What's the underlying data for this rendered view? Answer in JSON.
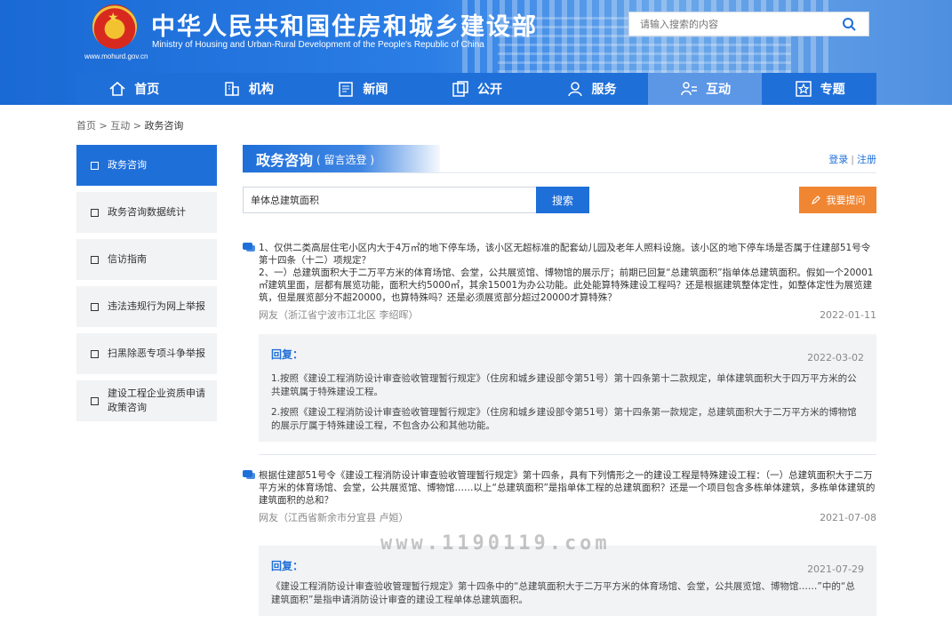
{
  "header": {
    "title": "中华人民共和国住房和城乡建设部",
    "subtitle": "Ministry of Housing and Urban-Rural Development of the People's Republic of China",
    "url": "www.mohurd.gov.cn",
    "search_placeholder": "请输入搜索的内容"
  },
  "nav": [
    {
      "label": "首页",
      "icon": "home-icon"
    },
    {
      "label": "机构",
      "icon": "building-icon"
    },
    {
      "label": "新闻",
      "icon": "news-icon"
    },
    {
      "label": "公开",
      "icon": "folder-icon"
    },
    {
      "label": "服务",
      "icon": "service-icon"
    },
    {
      "label": "互动",
      "icon": "interact-icon"
    },
    {
      "label": "专题",
      "icon": "star-icon"
    }
  ],
  "breadcrumb": {
    "home": "首页",
    "sep": ">",
    "section": "互动",
    "current": "政务咨询"
  },
  "sidebar": [
    {
      "label": "政务咨询"
    },
    {
      "label": "政务咨询数据统计"
    },
    {
      "label": "信访指南"
    },
    {
      "label": "违法违规行为网上举报"
    },
    {
      "label": "扫黑除恶专项斗争举报"
    },
    {
      "label": "建设工程企业资质申请政策咨询"
    }
  ],
  "main": {
    "title": "政务咨询",
    "title_note": "( 留言选登 )",
    "login": "登录",
    "register": "注册",
    "search_value": "单体总建筑面积",
    "search_button": "搜索",
    "ask_button": "我要提问"
  },
  "questions": [
    {
      "lines": [
        "1、仅供二类高层住宅小区内大于4万㎡的地下停车场，该小区无超标准的配套幼儿园及老年人照料设施。该小区的地下停车场是否属于住建部51号令第十四条（十二）项规定？",
        "2、一）总建筑面积大于二万平方米的体育场馆、会堂，公共展览馆、博物馆的展示厅；前期已回复“总建筑面积”指单体总建筑面积。假如一个20001㎡建筑里面，层都有展览功能，面积大约5000㎡，其余15001为办公功能。此处能算特殊建设工程吗？还是根据建筑整体定性，如整体定性为展览建筑，但是展览部分不超20000，也算特殊吗？还是必须展览部分超过20000才算特殊？"
      ],
      "user": "网友（浙江省宁波市江北区 李绍晖）",
      "date": "2022-01-11",
      "reply_label": "回复：",
      "reply_date": "2022-03-02",
      "reply": [
        "1.按照《建设工程消防设计审查验收管理暂行规定》（住房和城乡建设部令第51号）第十四条第十二款规定，单体建筑面积大于四万平方米的公共建筑属于特殊建设工程。",
        "2.按照《建设工程消防设计审查验收管理暂行规定》（住房和城乡建设部令第51号）第十四条第一款规定，总建筑面积大于二万平方米的博物馆的展示厅属于特殊建设工程，不包含办公和其他功能。"
      ]
    },
    {
      "lines": [
        "根据住建部51号令《建设工程消防设计审查验收管理暂行规定》第十四条，具有下列情形之一的建设工程是特殊建设工程：（一）总建筑面积大于二万平方米的体育场馆、会堂，公共展览馆、博物馆……以上“总建筑面积”是指单体工程的总建筑面积？还是一个项目包含多栋单体建筑，多栋单体建筑的建筑面积的总和？"
      ],
      "user": "网友（江西省新余市分宜县 卢姮）",
      "date": "2021-07-08",
      "reply_label": "回复：",
      "reply_date": "2021-07-29",
      "reply": [
        "《建设工程消防设计审查验收管理暂行规定》第十四条中的“总建筑面积大于二万平方米的体育场馆、会堂，公共展览馆、博物馆……”中的“总建筑面积”是指申请消防设计审查的建设工程单体总建筑面积。"
      ]
    }
  ],
  "watermark": "www.1190119.com",
  "colors": {
    "primary": "#1f6fd9",
    "accent": "#f08532",
    "panel": "#f2f3f5"
  }
}
